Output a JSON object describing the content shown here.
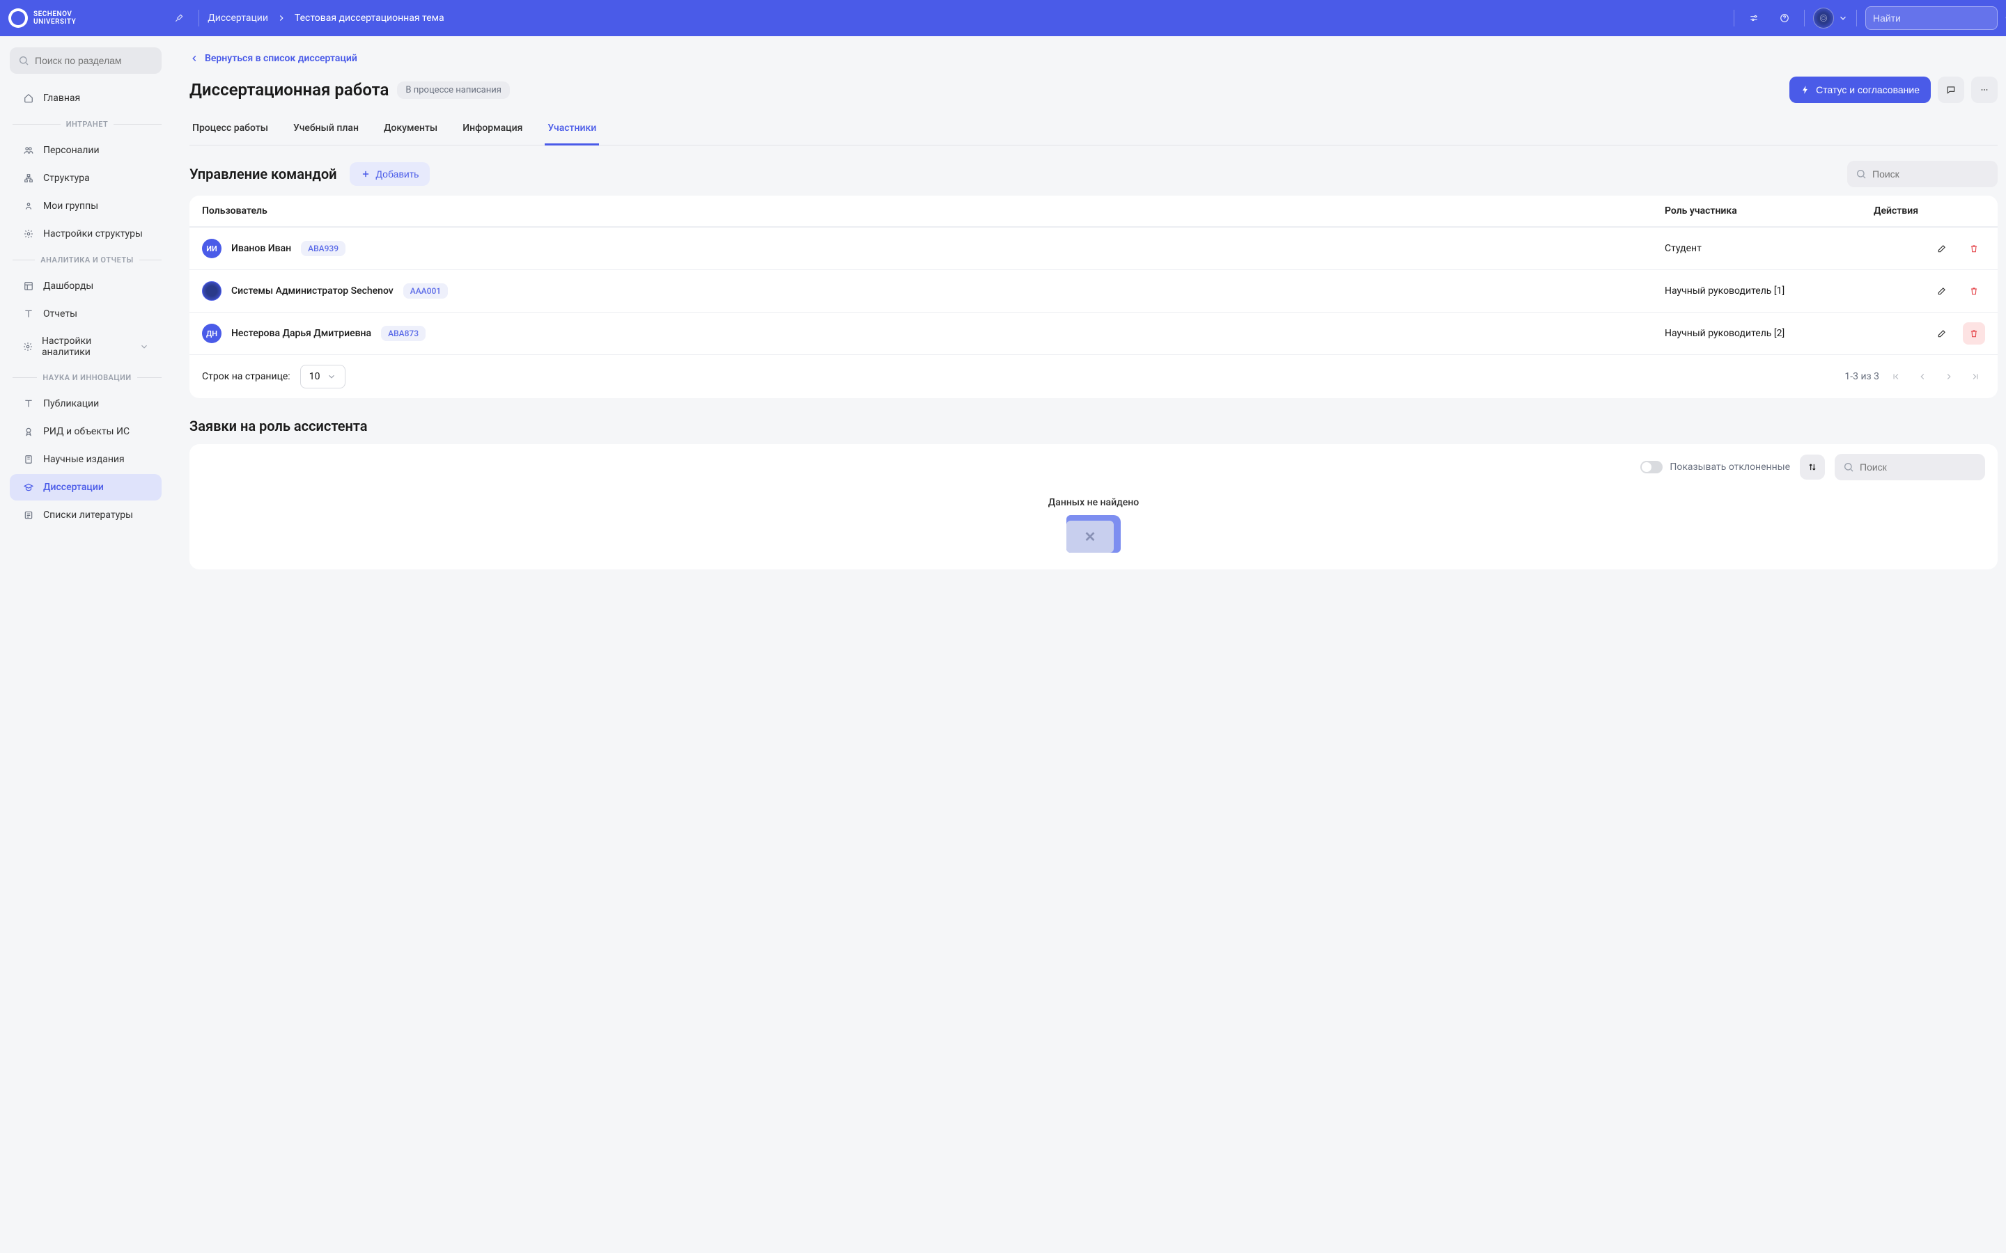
{
  "brand": {
    "line1": "SECHENOV",
    "line2": "UNIVERSITY"
  },
  "breadcrumb": {
    "root": "Диссертации",
    "current": "Тестовая диссертационная тема"
  },
  "top_search": {
    "placeholder": "Найти"
  },
  "sidebar": {
    "search_placeholder": "Поиск по разделам",
    "home": "Главная",
    "groups": {
      "intranet": "ИНТРАНЕТ",
      "analytics": "АНАЛИТИКА И ОТЧЕТЫ",
      "science": "НАУКА И ИННОВАЦИИ"
    },
    "items": {
      "personalii": "Персоналии",
      "structure": "Структура",
      "my_groups": "Мои группы",
      "structure_settings": "Настройки структуры",
      "dashboards": "Дашборды",
      "reports": "Отчеты",
      "analytics_settings": "Настройки аналитики",
      "publications": "Публикации",
      "rid": "РИД и объекты ИС",
      "scientific": "Научные издания",
      "dissertations": "Диссертации",
      "bibliography": "Списки литературы"
    }
  },
  "back_link": "Вернуться в список диссертаций",
  "page": {
    "title": "Диссертационная работа",
    "status": "В процессе написания",
    "status_button": "Статус и согласование"
  },
  "tabs": {
    "process": "Процесс работы",
    "plan": "Учебный план",
    "documents": "Документы",
    "info": "Информация",
    "participants": "Участники"
  },
  "team": {
    "title": "Управление командой",
    "add_button": "Добавить",
    "search_placeholder": "Поиск",
    "columns": {
      "user": "Пользователь",
      "role": "Роль участника",
      "actions": "Действия"
    },
    "rows": [
      {
        "initials": "ИИ",
        "avatar_type": "initials",
        "name": "Иванов Иван",
        "code": "АВА939",
        "role": "Студент"
      },
      {
        "initials": "",
        "avatar_type": "ring",
        "name": "Системы Администратор Sechenov",
        "code": "ААА001",
        "role": "Научный руководитель [1]"
      },
      {
        "initials": "ДН",
        "avatar_type": "initials",
        "name": "Нестерова Дарья Дмитриевна",
        "code": "АВА873",
        "role": "Научный руководитель [2]"
      }
    ],
    "rows_per_page_label": "Строк на странице:",
    "rows_per_page_value": "10",
    "pagination_info": "1-3 из 3"
  },
  "requests": {
    "title": "Заявки на роль ассистента",
    "show_rejected_label": "Показывать отклоненные",
    "search_placeholder": "Поиск",
    "empty_message": "Данных не найдено"
  },
  "colors": {
    "primary": "#4a5be8",
    "danger": "#e5484d"
  }
}
